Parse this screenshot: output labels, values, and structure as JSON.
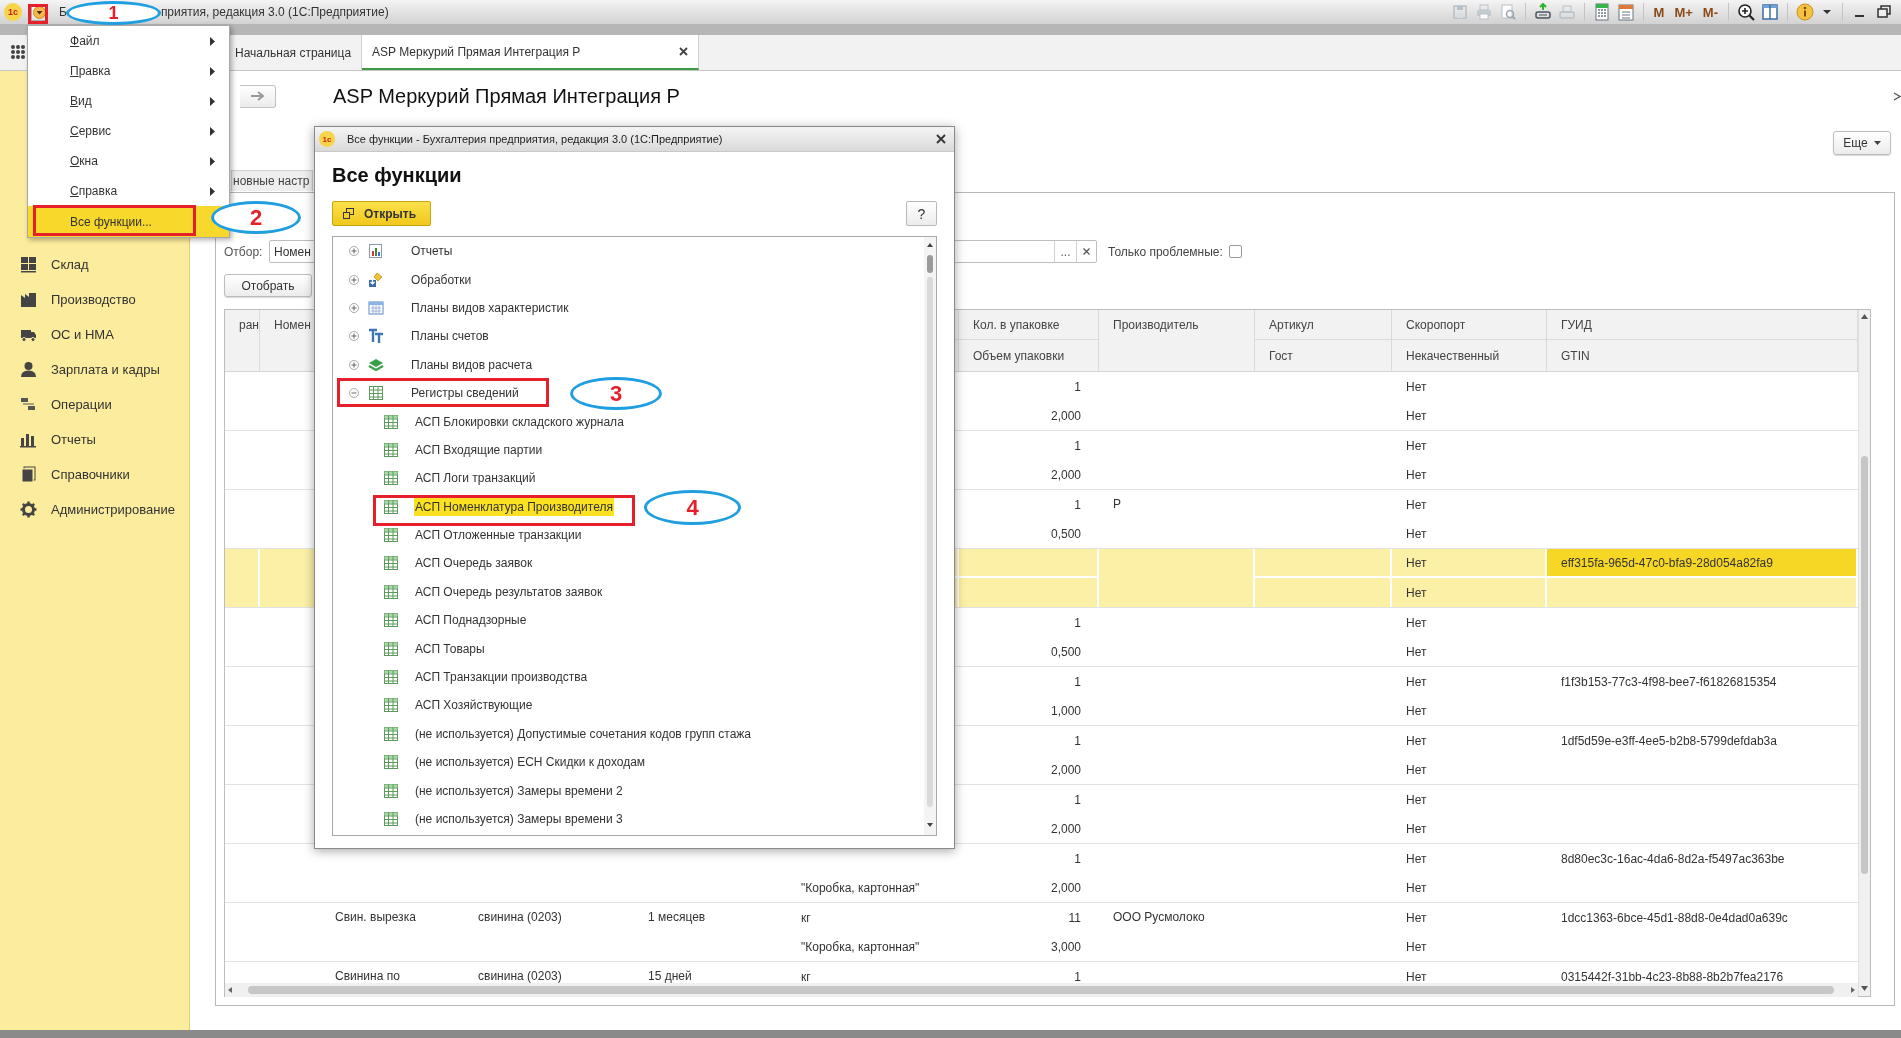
{
  "window": {
    "logo": "1с",
    "title_start": "Б",
    "title_end": "приятия, редакция 3.0  (1С:Предприятие)",
    "memory_buttons": [
      "M",
      "M+",
      "M-"
    ]
  },
  "main_menu": [
    {
      "label": "Файл",
      "submenu": true,
      "selected": false
    },
    {
      "label": "Правка",
      "submenu": true,
      "selected": false
    },
    {
      "label": "Вид",
      "submenu": true,
      "selected": false
    },
    {
      "label": "Сервис",
      "submenu": true,
      "selected": false
    },
    {
      "label": "Окна",
      "submenu": true,
      "selected": false
    },
    {
      "label": "Справка",
      "submenu": true,
      "selected": false
    },
    {
      "label": "Все функции...",
      "submenu": false,
      "selected": true
    }
  ],
  "tabs": [
    {
      "label": "Начальная страница",
      "selected": false,
      "closable": false
    },
    {
      "label": "ASP Меркурий Прямая Интеграция Р",
      "selected": true,
      "closable": true
    }
  ],
  "sidebar": {
    "items": [
      "Склад",
      "Производство",
      "ОС и НМА",
      "Зарплата и кадры",
      "Операции",
      "Отчеты",
      "Справочники",
      "Администрирование"
    ]
  },
  "form": {
    "title": "ASP Меркурий Прямая Интеграция Р",
    "more_button": "Еще",
    "settings_tab": "новные настр",
    "filter_label": "Отбор:",
    "filter_value": "Номен",
    "choose_button": "...",
    "only_problems": {
      "label": "Только проблемные:",
      "checked": false
    },
    "select_button": "Отобрать"
  },
  "table": {
    "header": {
      "column_1": "ран",
      "column_2": "Номен",
      "qty": "Кол. в упаковке",
      "volume": "Объем упаковки",
      "producer": "Производитель",
      "article": "Артикул",
      "gost": "Гост",
      "spoils": "Скоропорт",
      "defective": "Некачественный",
      "guid": "ГУИД",
      "gtin": "GTIN"
    },
    "rows": [
      {
        "selected": false,
        "qty": "1",
        "volume": "2,000",
        "spoils": "Нет",
        "defective": "Нет"
      },
      {
        "selected": false,
        "qty": "1",
        "volume": "2,000",
        "spoils": "Нет",
        "defective": "Нет"
      },
      {
        "selected": false,
        "qty": "1",
        "volume": "0,500",
        "producer": "Р",
        "spoils": "Нет",
        "defective": "Нет"
      },
      {
        "selected": true,
        "spoils": "Нет",
        "defective": "Нет",
        "guid": "eff315fa-965d-47c0-bfa9-28d054a82fa9"
      },
      {
        "selected": false,
        "qty": "1",
        "volume": "0,500",
        "spoils": "Нет",
        "defective": "Нет"
      },
      {
        "selected": false,
        "qty": "1",
        "volume": "1,000",
        "spoils": "Нет",
        "defective": "Нет",
        "guid": "f1f3b153-77c3-4f98-bee7-f61826815354"
      },
      {
        "selected": false,
        "qty": "1",
        "volume": "2,000",
        "spoils": "Нет",
        "defective": "Нет",
        "guid": "1df5d59e-e3ff-4ee5-b2b8-5799defdab3a"
      },
      {
        "selected": false,
        "qty": "1",
        "volume": "2,000",
        "spoils": "Нет",
        "defective": "Нет"
      },
      {
        "selected": false,
        "column_6_line_2": "\"Коробка, картонная\"",
        "qty": "1",
        "volume": "2,000",
        "spoils": "Нет",
        "defective": "Нет",
        "guid": "8d80ec3c-16ac-4da6-8d2a-f5497ac363be"
      },
      {
        "selected": false,
        "column_3": "Свин. вырезка",
        "column_4": "свинина (0203)",
        "column_5": "1 месяцев",
        "column_6": "кг",
        "column_6_line_2": "\"Коробка, картонная\"",
        "qty": "11",
        "volume": "3,000",
        "producer": "ООО Русмолоко",
        "spoils": "Нет",
        "defective": "Нет",
        "guid": "1dcc1363-6bce-45d1-88d8-0e4dad0a639c"
      },
      {
        "selected": false,
        "column_3": "Свинина по",
        "column_4": "свинина (0203)",
        "column_5": "15 дней",
        "column_6": "кг",
        "qty": "1",
        "spoils": "Нет",
        "guid": "0315442f-31bb-4c23-8b88-8b2b7fea2176"
      }
    ]
  },
  "dialog": {
    "logo": "1с",
    "title": "Все функции - Бухгалтерия предприятия, редакция 3.0  (1С:Предприятие)",
    "heading": "Все функции",
    "open_button": "Открыть",
    "help_button": "?",
    "tree": [
      {
        "label": "Отчеты",
        "expanded": false,
        "selected": false
      },
      {
        "label": "Обработки",
        "expanded": false,
        "selected": false
      },
      {
        "label": "Планы видов характеристик",
        "expanded": false,
        "selected": false
      },
      {
        "label": "Планы счетов",
        "expanded": false,
        "selected": false
      },
      {
        "label": "Планы видов расчета",
        "expanded": false,
        "selected": false
      },
      {
        "label": "Регистры сведений",
        "expanded": true,
        "selected": false,
        "children": [
          {
            "label": "АСП Блокировки складского журнала",
            "selected": false
          },
          {
            "label": "АСП Входящие партии",
            "selected": false
          },
          {
            "label": "АСП Логи транзакций",
            "selected": false
          },
          {
            "label": "АСП Номенклатура Производителя",
            "selected": true
          },
          {
            "label": "АСП Отложенные транзакции",
            "selected": false
          },
          {
            "label": "АСП Очередь заявок",
            "selected": false
          },
          {
            "label": "АСП Очередь результатов заявок",
            "selected": false
          },
          {
            "label": "АСП Поднадзорные",
            "selected": false
          },
          {
            "label": "АСП Товары",
            "selected": false
          },
          {
            "label": "АСП Транзакции производства",
            "selected": false
          },
          {
            "label": "АСП Хозяйствующие",
            "selected": false
          },
          {
            "label": "(не используется) Допустимые сочетания кодов групп стажа",
            "selected": false
          },
          {
            "label": "(не используется) ЕСН Скидки к доходам",
            "selected": false
          },
          {
            "label": "(не используется) Замеры времени 2",
            "selected": false
          },
          {
            "label": "(не используется) Замеры времени 3",
            "selected": false
          }
        ]
      }
    ]
  },
  "annotations": [
    {
      "number": "1"
    },
    {
      "number": "2"
    },
    {
      "number": "3"
    },
    {
      "number": "4"
    }
  ]
}
